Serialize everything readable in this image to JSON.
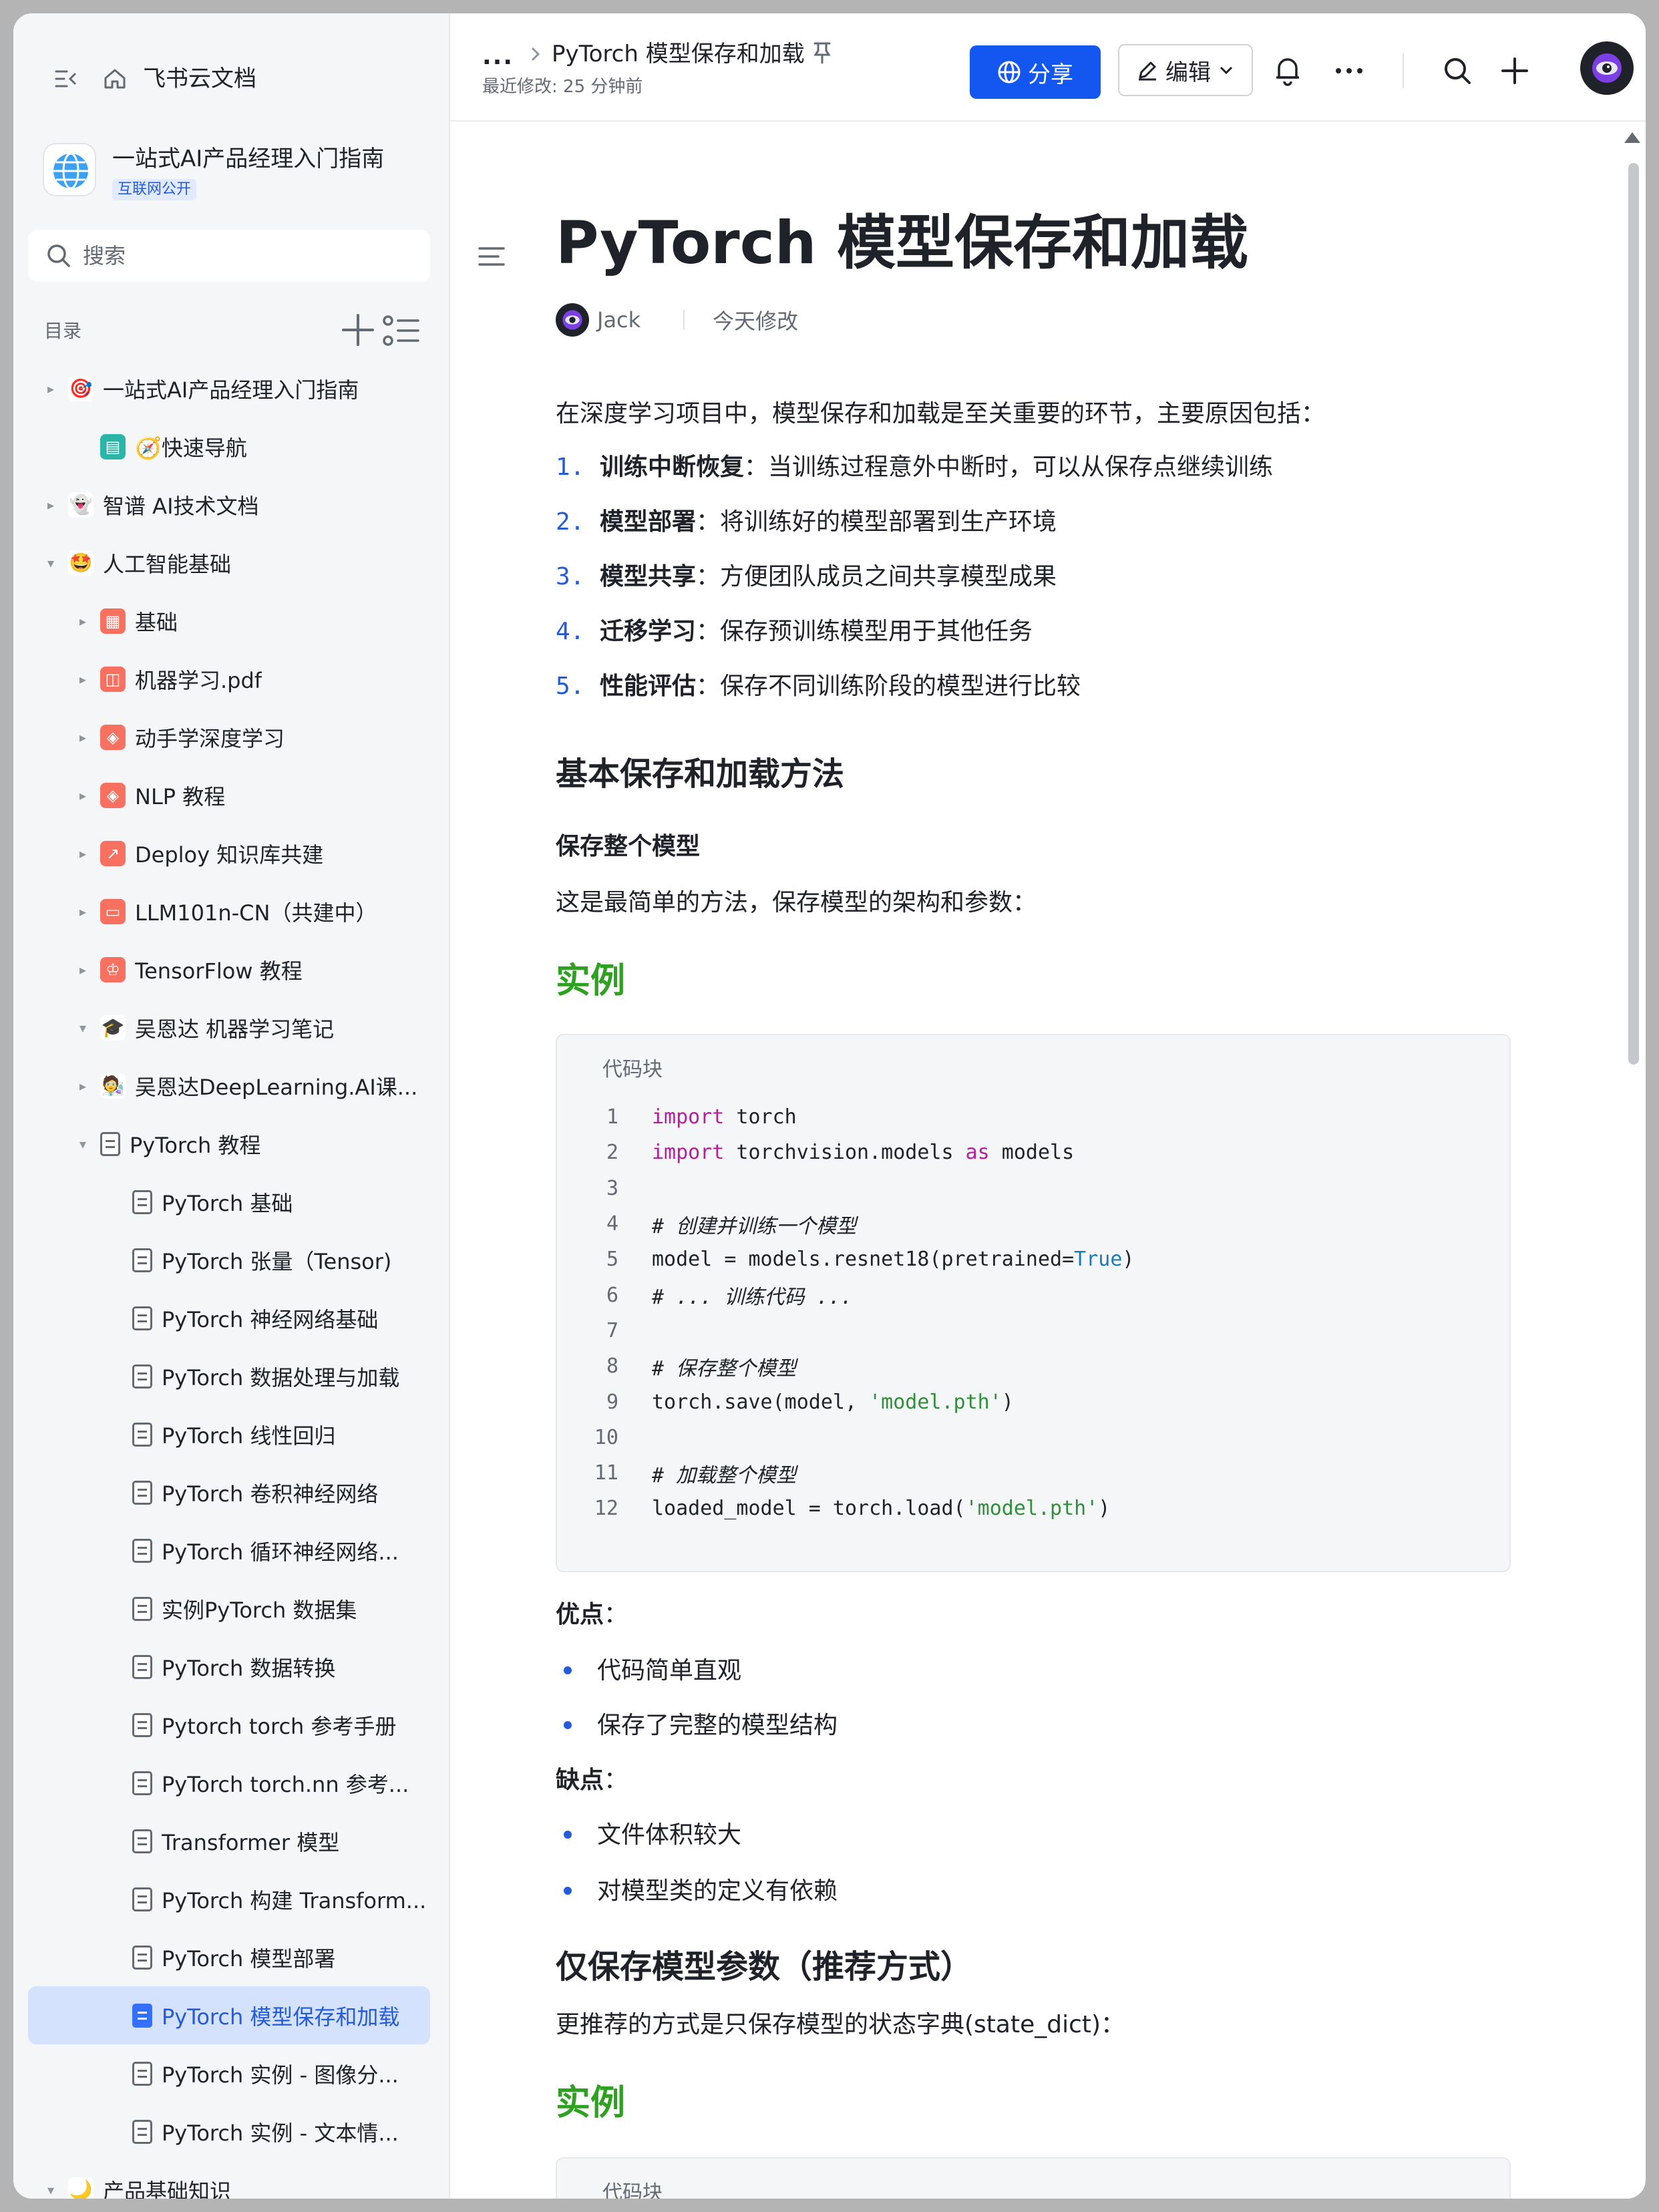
{
  "sidebar": {
    "brand": "飞书云文档",
    "space_name": "一站式AI产品经理入门指南",
    "space_tag": "互联网公开",
    "search_placeholder": "搜索",
    "toc_label": "目录",
    "items": [
      {
        "label": "一站式AI产品经理入门指南",
        "level": 0,
        "arrow": "▸",
        "icon": "target-emoji-icon",
        "color": "#ffffff"
      },
      {
        "label": "🧭快速导航",
        "level": 1,
        "arrow": "",
        "icon": "board-icon",
        "color": "#2bb5a9"
      },
      {
        "label": "智谱 AI技术文档",
        "level": 0,
        "arrow": "▸",
        "icon": "ghost-emoji-icon",
        "color": "#ffffff"
      },
      {
        "label": "人工智能基础",
        "level": 0,
        "arrow": "▾",
        "icon": "star-eyes-emoji-icon",
        "color": "#ffffff"
      },
      {
        "label": "基础",
        "level": 1,
        "arrow": "▸",
        "icon": "grid-icon",
        "color": "#f87060"
      },
      {
        "label": "机器学习.pdf",
        "level": 1,
        "arrow": "▸",
        "icon": "gamepad-icon",
        "color": "#f87060"
      },
      {
        "label": "动手学深度学习",
        "level": 1,
        "arrow": "▸",
        "icon": "layers-icon",
        "color": "#f87060"
      },
      {
        "label": "NLP 教程",
        "level": 1,
        "arrow": "▸",
        "icon": "layers-icon",
        "color": "#f87060"
      },
      {
        "label": "Deploy 知识库共建",
        "level": 1,
        "arrow": "▸",
        "icon": "trend-icon",
        "color": "#f87060"
      },
      {
        "label": "LLM101n-CN（共建中）",
        "level": 1,
        "arrow": "▸",
        "icon": "monitor-icon",
        "color": "#f87060"
      },
      {
        "label": "TensorFlow 教程",
        "level": 1,
        "arrow": "▸",
        "icon": "trophy-icon",
        "color": "#f87060"
      },
      {
        "label": "吴恩达 机器学习笔记",
        "level": 1,
        "arrow": "▾",
        "icon": "grad-cap-emoji-icon",
        "color": "#ffffff"
      },
      {
        "label": "吴恩达DeepLearning.AI课...",
        "level": 1,
        "arrow": "▸",
        "icon": "scientist-emoji-icon",
        "color": "#ffffff"
      },
      {
        "label": "PyTorch 教程",
        "level": 1,
        "arrow": "▾",
        "icon": "doc-icon",
        "color": "doc"
      },
      {
        "label": "PyTorch 基础",
        "level": 2,
        "arrow": "",
        "icon": "doc-icon",
        "color": "doc"
      },
      {
        "label": "PyTorch 张量（Tensor)",
        "level": 2,
        "arrow": "",
        "icon": "doc-icon",
        "color": "doc"
      },
      {
        "label": "PyTorch 神经网络基础",
        "level": 2,
        "arrow": "",
        "icon": "doc-icon",
        "color": "doc"
      },
      {
        "label": "PyTorch 数据处理与加载",
        "level": 2,
        "arrow": "",
        "icon": "doc-icon",
        "color": "doc"
      },
      {
        "label": "PyTorch 线性回归",
        "level": 2,
        "arrow": "",
        "icon": "doc-icon",
        "color": "doc"
      },
      {
        "label": "PyTorch 卷积神经网络",
        "level": 2,
        "arrow": "",
        "icon": "doc-icon",
        "color": "doc"
      },
      {
        "label": "PyTorch 循环神经网络...",
        "level": 2,
        "arrow": "",
        "icon": "doc-icon",
        "color": "doc"
      },
      {
        "label": "实例PyTorch 数据集",
        "level": 2,
        "arrow": "",
        "icon": "doc-icon",
        "color": "doc"
      },
      {
        "label": "PyTorch 数据转换",
        "level": 2,
        "arrow": "",
        "icon": "doc-icon",
        "color": "doc"
      },
      {
        "label": "Pytorch torch 参考手册",
        "level": 2,
        "arrow": "",
        "icon": "doc-icon",
        "color": "doc"
      },
      {
        "label": "PyTorch torch.nn 参考...",
        "level": 2,
        "arrow": "",
        "icon": "doc-icon",
        "color": "doc"
      },
      {
        "label": "Transformer 模型",
        "level": 2,
        "arrow": "",
        "icon": "doc-icon",
        "color": "doc"
      },
      {
        "label": "PyTorch 构建 Transform...",
        "level": 2,
        "arrow": "",
        "icon": "doc-icon",
        "color": "doc"
      },
      {
        "label": "PyTorch 模型部署",
        "level": 2,
        "arrow": "",
        "icon": "doc-icon",
        "color": "doc"
      },
      {
        "label": "PyTorch 模型保存和加载",
        "level": 2,
        "arrow": "",
        "icon": "doc-icon",
        "color": "doc",
        "active": true
      },
      {
        "label": "PyTorch 实例 - 图像分...",
        "level": 2,
        "arrow": "",
        "icon": "doc-icon",
        "color": "doc"
      },
      {
        "label": "PyTorch 实例 - 文本情...",
        "level": 2,
        "arrow": "",
        "icon": "doc-icon",
        "color": "doc"
      },
      {
        "label": "产品基础知识",
        "level": 0,
        "arrow": "▾",
        "icon": "moon-emoji-icon",
        "color": "#ffffff"
      }
    ]
  },
  "header": {
    "breadcrumb_more": "...",
    "doc_title": "PyTorch 模型保存和加载",
    "last_modified": "最近修改: 25 分钟前",
    "share_label": "分享",
    "edit_label": "编辑"
  },
  "doc": {
    "title": "PyTorch 模型保存和加载",
    "author": "Jack",
    "modified": "今天修改",
    "intro": "在深度学习项目中，模型保存和加载是至关重要的环节，主要原因包括：",
    "reasons": [
      {
        "num": "1.",
        "term": "训练中断恢复",
        "desc": "：当训练过程意外中断时，可以从保存点继续训练"
      },
      {
        "num": "2.",
        "term": "模型部署",
        "desc": "：将训练好的模型部署到生产环境"
      },
      {
        "num": "3.",
        "term": "模型共享",
        "desc": "：方便团队成员之间共享模型成果"
      },
      {
        "num": "4.",
        "term": "迁移学习",
        "desc": "：保存预训练模型用于其他任务"
      },
      {
        "num": "5.",
        "term": "性能评估",
        "desc": "：保存不同训练阶段的模型进行比较"
      }
    ],
    "h2_basic": "基本保存和加载方法",
    "h3_whole": "保存整个模型",
    "p_whole": "这是最简单的方法，保存模型的架构和参数：",
    "example_label": "实例",
    "code_label": "代码块",
    "code_lines": [
      "1",
      "2",
      "3",
      "4",
      "5",
      "6",
      "7",
      "8",
      "9",
      "10",
      "11",
      "12"
    ],
    "pros_label": "优点",
    "pros": [
      "代码简单直观",
      "保存了完整的模型结构"
    ],
    "cons_label": "缺点",
    "cons": [
      "文件体积较大",
      "对模型类的定义有依赖"
    ],
    "h2_params": "仅保存模型参数（推荐方式）",
    "p_params": "更推荐的方式是只保存模型的状态字典(state_dict)：",
    "example_label_2": "实例",
    "code_label_2": "代码块"
  }
}
